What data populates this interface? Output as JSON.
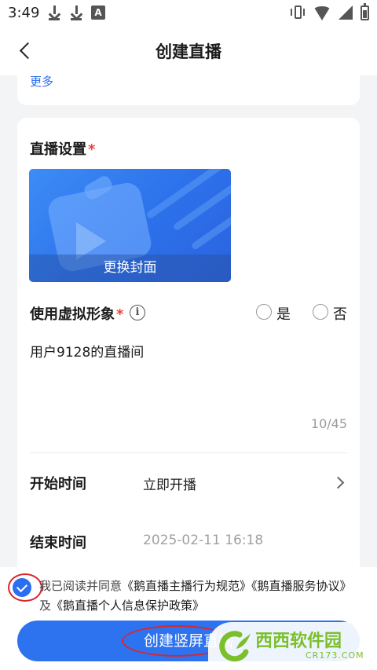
{
  "status_bar": {
    "time": "3:49",
    "left_icons": [
      "download-icon",
      "download-icon",
      "a-icon"
    ],
    "right_icons": [
      "vibrate-icon",
      "wifi-icon",
      "signal-icon",
      "battery-icon"
    ]
  },
  "header": {
    "title": "创建直播",
    "back_icon": "back-arrow-icon"
  },
  "top_card": {
    "more_label": "更多"
  },
  "live_settings": {
    "section_title": "直播设置",
    "required_mark": "*",
    "cover_button": "更换封面",
    "avatar_label": "使用虚拟形象",
    "avatar_required": "*",
    "info_icon_glyph": "i",
    "option_yes": "是",
    "option_no": "否",
    "title_value": "用户9128的直播间",
    "char_counter": "10/45",
    "start_time_label": "开始时间",
    "start_time_value": "立即开播",
    "end_time_label": "结束时间",
    "end_time_value": "2025-02-11 16:18"
  },
  "agreement": {
    "prefix": "我已阅读并同意",
    "link1": "《鹅直播主播行为规范》",
    "link2": "《鹅直播服务协议》",
    "joiner": "及",
    "link3": "《鹅直播个人信息保护政策》",
    "checked": true
  },
  "create_button": {
    "label": "创建竖屏直播"
  },
  "watermark": {
    "brand": "西西软件园",
    "domain": "CR173.COM"
  },
  "colors": {
    "accent": "#2d73f0",
    "link_blue": "#2a6ff0",
    "required_red": "#e8453c",
    "annotation_red": "#d9262c",
    "page_bg": "#f3f4f6"
  }
}
